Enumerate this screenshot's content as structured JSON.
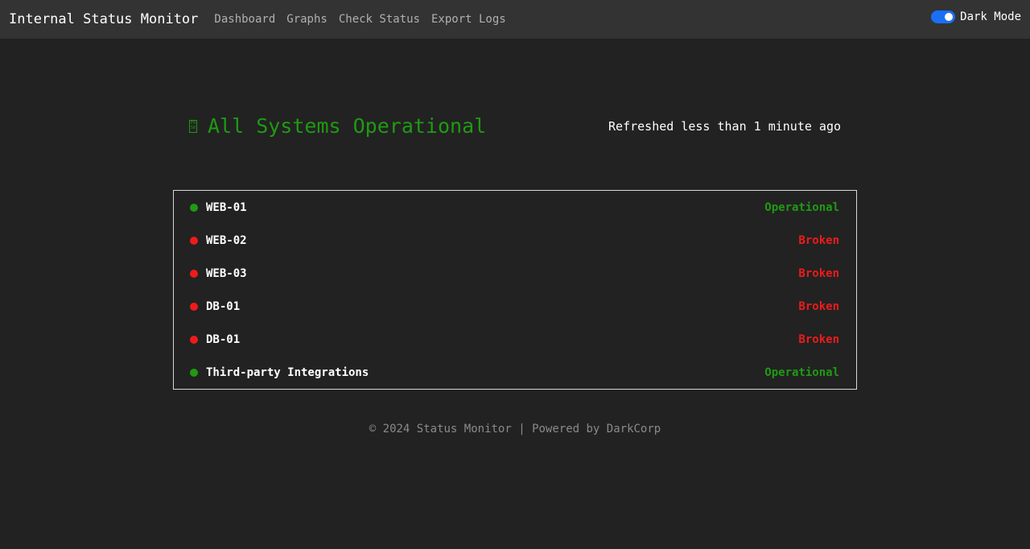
{
  "navbar": {
    "brand": "Internal Status Monitor",
    "links": [
      "Dashboard",
      "Graphs",
      "Check Status",
      "Export Logs"
    ],
    "theme_label": "Dark Mode",
    "theme_toggle_on": true,
    "accent_color": "#1a6ff5"
  },
  "summary": {
    "icon": "status-glyph-icon",
    "title": "All Systems Operational",
    "refreshed": "Refreshed less than 1 minute ago",
    "color": "#1f9a13"
  },
  "services": [
    {
      "name": "WEB-01",
      "status": "Operational",
      "state": "ok"
    },
    {
      "name": "WEB-02",
      "status": "Broken",
      "state": "bad"
    },
    {
      "name": "WEB-03",
      "status": "Broken",
      "state": "bad"
    },
    {
      "name": "DB-01",
      "status": "Broken",
      "state": "bad"
    },
    {
      "name": "DB-01",
      "status": "Broken",
      "state": "bad"
    },
    {
      "name": "Third-party Integrations",
      "status": "Operational",
      "state": "ok"
    }
  ],
  "status_colors": {
    "ok": "#1f9a13",
    "bad": "#ee1b1b"
  },
  "footer": {
    "text": "© 2024 Status Monitor | Powered by DarkCorp"
  }
}
